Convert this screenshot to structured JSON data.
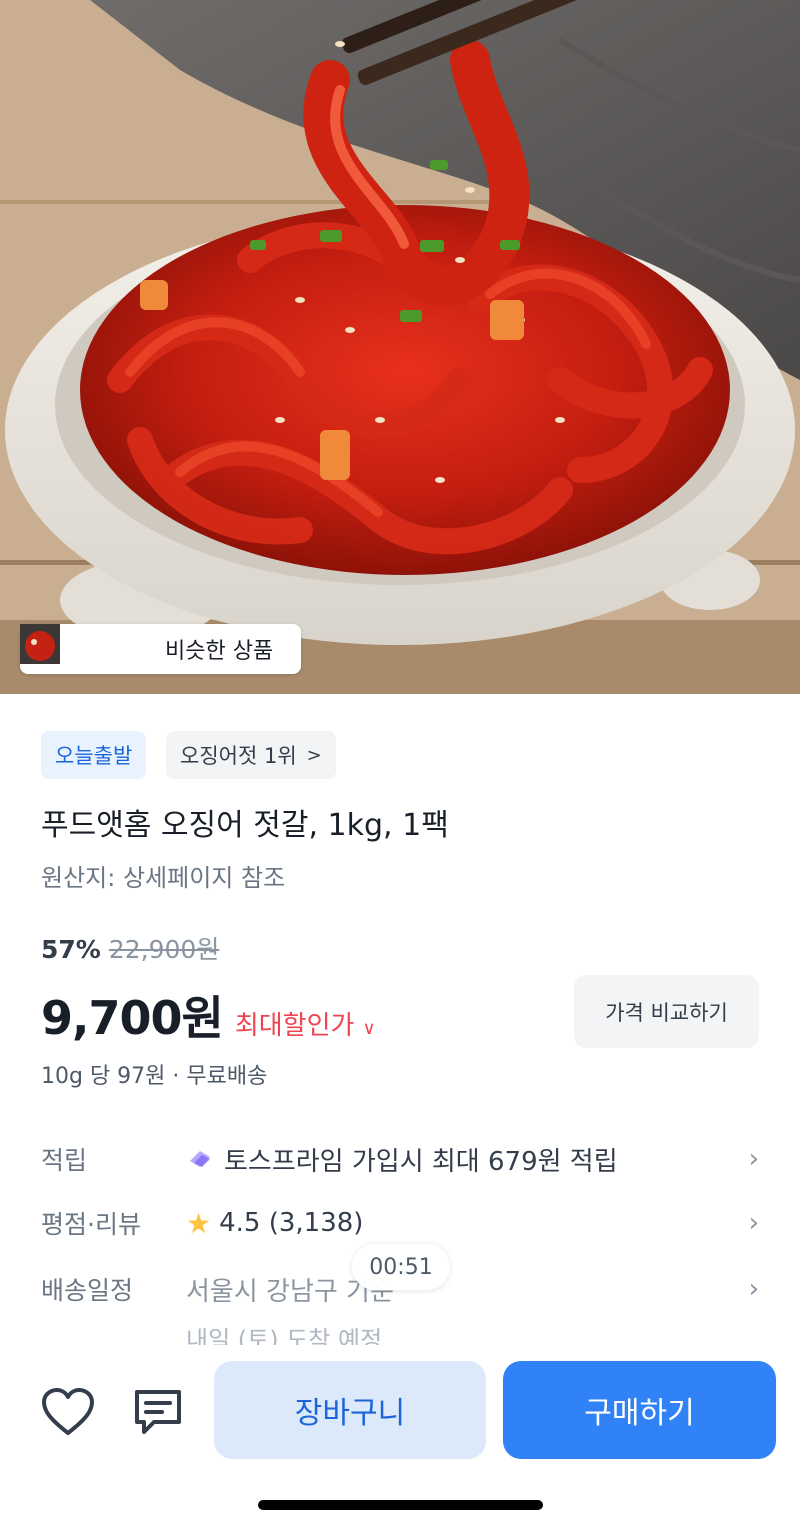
{
  "hero": {
    "similar_label": "비슷한 상품"
  },
  "badges": {
    "today_ship": "오늘출발",
    "rank": "오징어젓 1위"
  },
  "product": {
    "title": "푸드앳홈 오징어 젓갈, 1kg, 1팩",
    "origin": "원산지: 상세페이지 참조",
    "discount": "57%",
    "original_price": "22,900원",
    "price": "9,700원",
    "max_deal": "최대할인가",
    "compare_label": "가격 비교하기",
    "unit_info": "10g 당 97원 · 무료배송"
  },
  "info": {
    "points_label": "적립",
    "points_value": "토스프라임 가입시 최대 679원 적립",
    "rating_label": "평점·리뷰",
    "rating_value": "4.5 (3,138)",
    "shipping_label": "배송일정",
    "shipping_value": "서울시 강남구 기준",
    "shipping_sub": "내일 (토) 도착 예정"
  },
  "timer": "00:51",
  "actions": {
    "cart": "장바구니",
    "buy": "구매하기"
  },
  "icons": [
    "heart-icon",
    "chat-icon",
    "chevron-right-icon",
    "star-icon",
    "toss-prime-icon",
    "chevron-down-icon"
  ],
  "colors": {
    "primary": "#3182f6",
    "cart_bg": "#dbe9fb",
    "sale_red": "#f04452",
    "star": "#ffc342"
  }
}
